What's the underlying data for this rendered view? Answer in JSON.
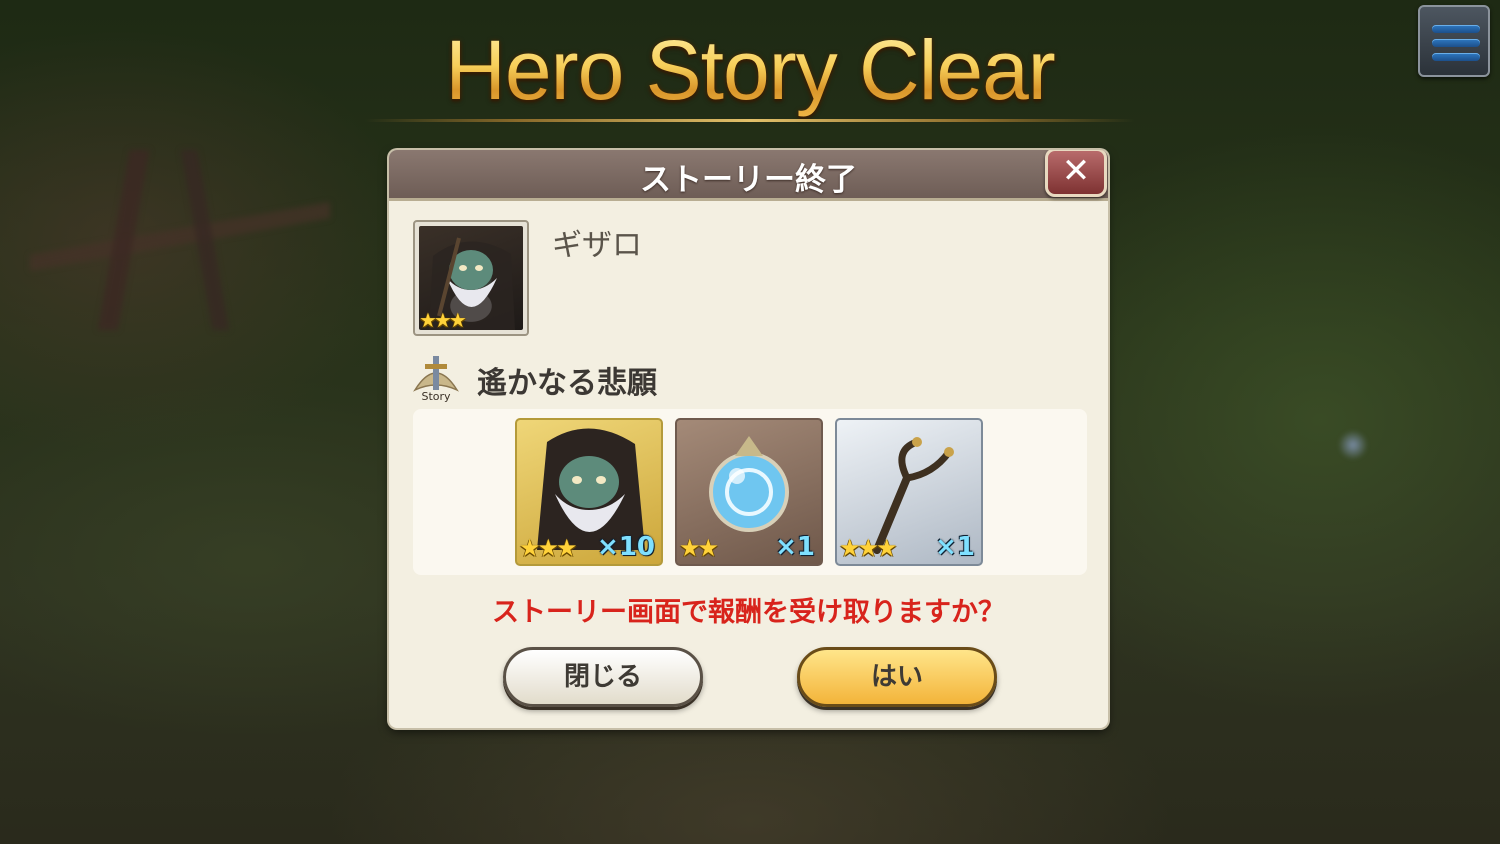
{
  "banner": {
    "title": "Hero Story Clear"
  },
  "menu": {
    "icon": "hamburger-menu-icon"
  },
  "dialog": {
    "title": "ストーリー終了",
    "close_icon": "close-x-icon",
    "hero": {
      "name": "ギザロ",
      "rarity_stars": 3
    },
    "story": {
      "icon": "story-sword-icon",
      "icon_text": "Story",
      "title": "遙かなる悲願"
    },
    "rewards": [
      {
        "name": "hero-shard",
        "stars": 3,
        "qty": "×10"
      },
      {
        "name": "blue-orb",
        "stars": 2,
        "qty": "×1"
      },
      {
        "name": "staff",
        "stars": 3,
        "qty": "×1"
      }
    ],
    "question": "ストーリー画面で報酬を受け取りますか？",
    "buttons": {
      "close": "閉じる",
      "yes": "はい"
    }
  },
  "colors": {
    "title_gold": "#f4c24a",
    "question_red": "#d8241c",
    "yes_button": "#f3b43a",
    "header_brown": "#7a6a62"
  }
}
